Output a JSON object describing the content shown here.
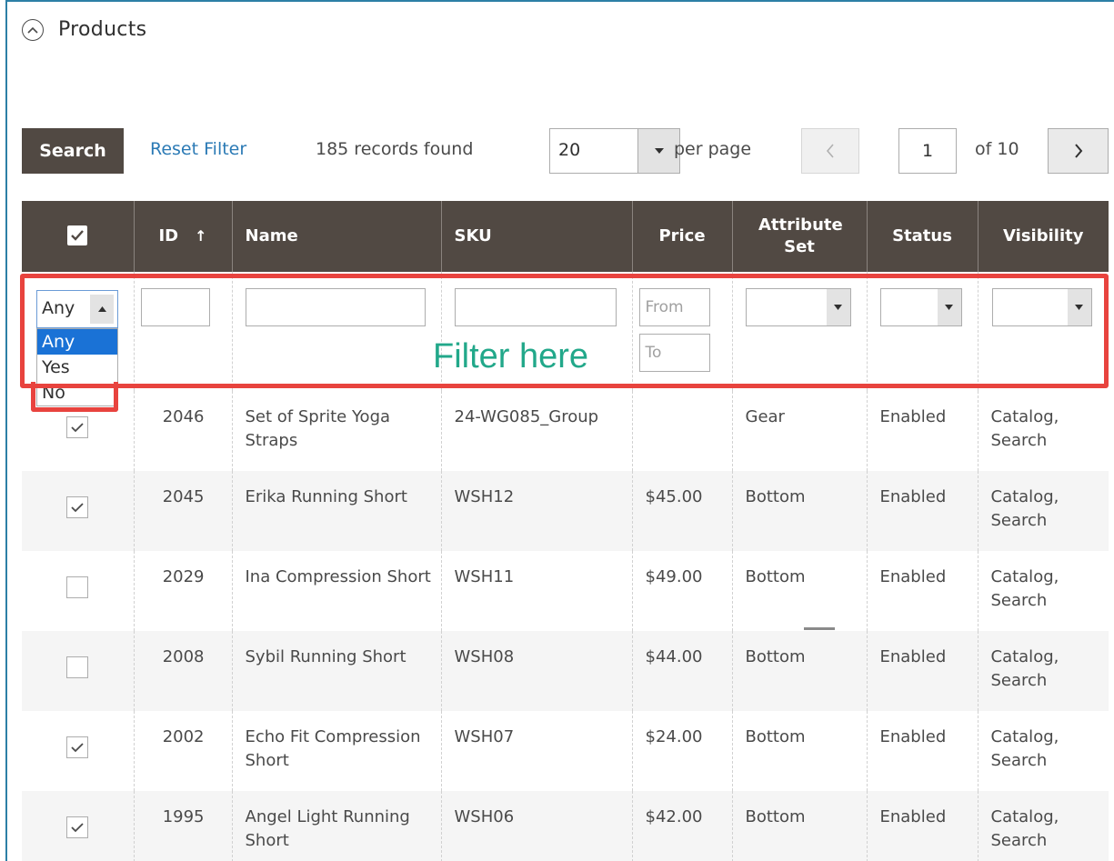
{
  "section": {
    "title": "Products",
    "collapse_icon": "chevron-up-circle-icon"
  },
  "toolbar": {
    "search_label": "Search",
    "reset_label": "Reset Filter",
    "records_text": "185 records found",
    "per_page_value": "20",
    "per_page_label": "per page",
    "current_page": "1",
    "total_pages_text": "of 10"
  },
  "columns": {
    "id": "ID",
    "sort_arrow": "↑",
    "name": "Name",
    "sku": "SKU",
    "price": "Price",
    "attribute_set": "Attribute Set",
    "status": "Status",
    "visibility": "Visibility"
  },
  "filters": {
    "in_products_value": "Any",
    "in_products_options": [
      "Any",
      "Yes",
      "No"
    ],
    "price_from_placeholder": "From",
    "price_to_placeholder": "To",
    "annotation": "Filter here"
  },
  "rows": [
    {
      "checked": true,
      "id": "2046",
      "name": "Set of Sprite Yoga Straps",
      "sku": "24-WG085_Group",
      "price": "",
      "attribute_set": "Gear",
      "status": "Enabled",
      "visibility": "Catalog, Search"
    },
    {
      "checked": true,
      "id": "2045",
      "name": "Erika Running Short",
      "sku": "WSH12",
      "price": "$45.00",
      "attribute_set": "Bottom",
      "status": "Enabled",
      "visibility": "Catalog, Search"
    },
    {
      "checked": false,
      "id": "2029",
      "name": "Ina Compression Short",
      "sku": "WSH11",
      "price": "$49.00",
      "attribute_set": "Bottom",
      "status": "Enabled",
      "visibility": "Catalog, Search"
    },
    {
      "checked": false,
      "id": "2008",
      "name": "Sybil Running Short",
      "sku": "WSH08",
      "price": "$44.00",
      "attribute_set": "Bottom",
      "status": "Enabled",
      "visibility": "Catalog, Search"
    },
    {
      "checked": true,
      "id": "2002",
      "name": "Echo Fit Compression Short",
      "sku": "WSH07",
      "price": "$24.00",
      "attribute_set": "Bottom",
      "status": "Enabled",
      "visibility": "Catalog, Search"
    },
    {
      "checked": true,
      "id": "1995",
      "name": "Angel Light Running Short",
      "sku": "WSH06",
      "price": "$42.00",
      "attribute_set": "Bottom",
      "status": "Enabled",
      "visibility": "Catalog, Search"
    }
  ],
  "colors": {
    "header_bg": "#514943",
    "link": "#2b7ab5",
    "highlight_box": "#e8433e",
    "annotation_text": "#22a88a",
    "selected_option": "#1a72d6"
  }
}
